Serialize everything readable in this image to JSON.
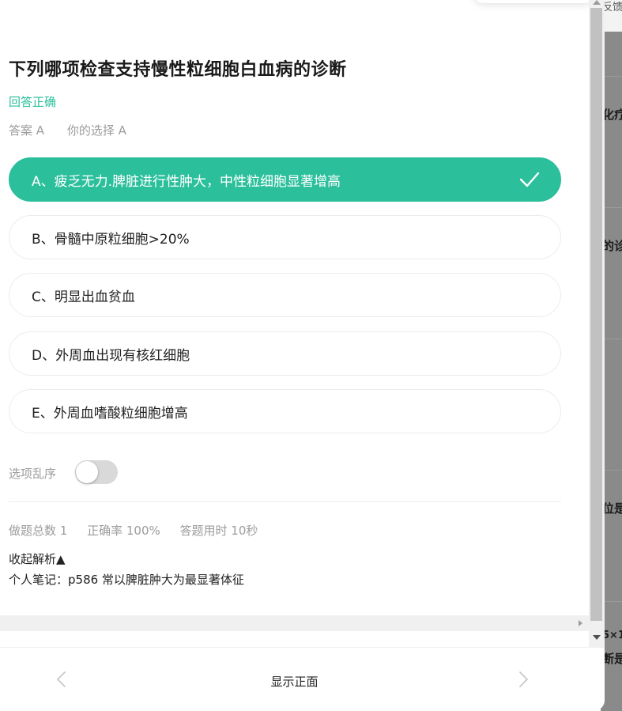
{
  "question": {
    "title": "下列哪项检查支持慢性粒细胞白血病的诊断",
    "result": "回答正确",
    "correct_answer": "答案 A",
    "your_choice": "你的选择 A"
  },
  "options": [
    {
      "label": "A、疲乏无力.脾脏进行性肿大，中性粒细胞显著增高",
      "state": "correct"
    },
    {
      "label": "B、骨髓中原粒细胞>20%",
      "state": "normal"
    },
    {
      "label": "C、明显出血贫血",
      "state": "normal"
    },
    {
      "label": "D、外周血出现有核红细胞",
      "state": "normal"
    },
    {
      "label": "E、外周血嗜酸粒细胞增高",
      "state": "normal"
    }
  ],
  "shuffle": {
    "label": "选项乱序",
    "enabled": false
  },
  "stats": {
    "total": "做题总数 1",
    "accuracy": "正确率 100%",
    "time": "答题用时 10秒"
  },
  "analysis": {
    "collapse_label": "收起解析▲",
    "note": "个人笔记：p586 常以脾脏肿大为最显著体征"
  },
  "nav": {
    "center_label": "显示正面",
    "prev_icon": "chevron-left-icon",
    "next_icon": "chevron-right-icon"
  },
  "background_fragments": [
    "反馈",
    "化疗",
    "的诊",
    "位是",
    "5×1",
    "断是"
  ],
  "colors": {
    "accent": "#2bbf9c",
    "muted_text": "#9c9c9c",
    "main_text": "#222222"
  }
}
